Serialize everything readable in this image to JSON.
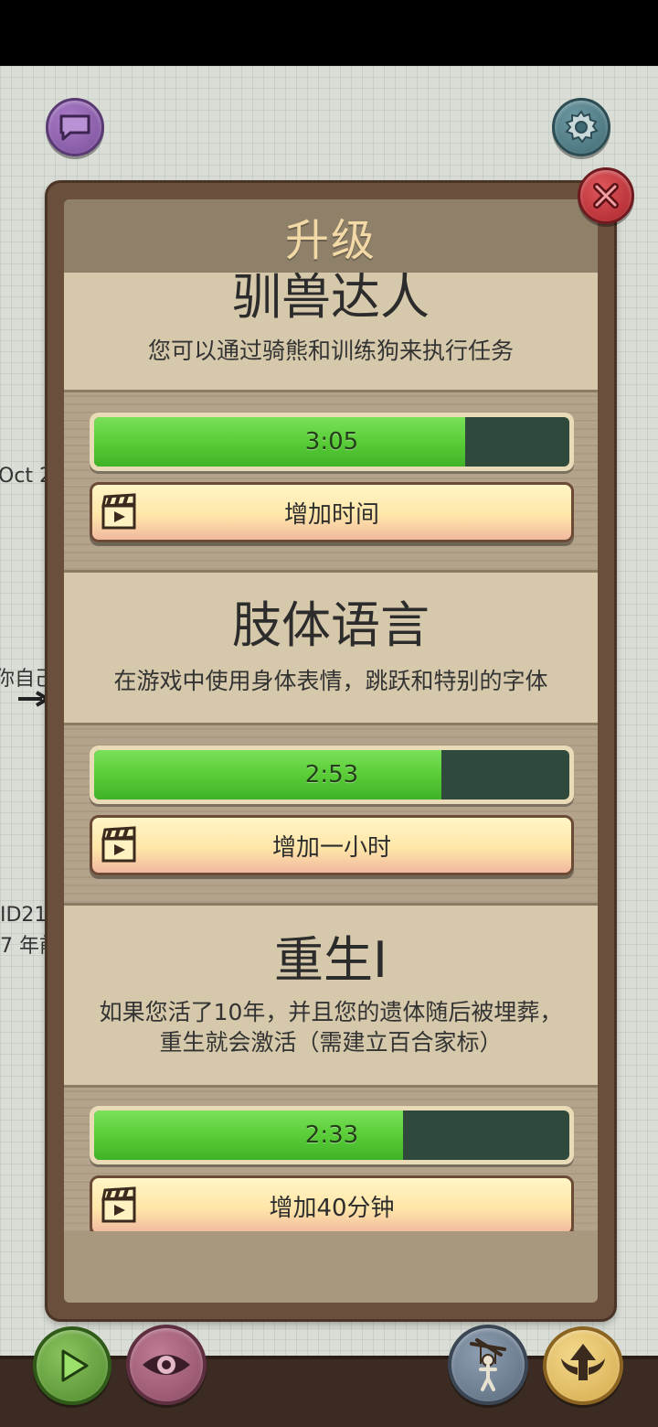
{
  "background": {
    "fragments": [
      "Oct 2",
      "你自己",
      "ID21",
      "7 年前"
    ]
  },
  "dialog": {
    "title": "升级",
    "cards": [
      {
        "title": "驯兽达人",
        "description": [
          "您可以通过骑熊和训练狗来执行任务"
        ],
        "timer": "3:05",
        "progress": 0.78,
        "button_label": "增加时间"
      },
      {
        "title": "肢体语言",
        "description": [
          "在游戏中使用身体表情，跳跃和特别的字体"
        ],
        "timer": "2:53",
        "progress": 0.73,
        "button_label": "增加一小时"
      },
      {
        "title": "重生I",
        "description": [
          "如果您活了10年，并且您的遗体随后被埋葬，",
          "重生就会激活（需建立百合家标）"
        ],
        "timer": "2:33",
        "progress": 0.65,
        "button_label": "增加40分钟"
      }
    ]
  },
  "icons": {
    "chat": "chat-bubble-icon",
    "settings": "gear-icon",
    "close": "close-icon",
    "play": "play-icon",
    "view": "eye-icon",
    "puppet": "puppet-icon",
    "upgrade": "winged-arrow-icon",
    "video": "clapperboard-icon"
  },
  "colors": {
    "progress_fill": "#5ccf3a",
    "progress_track": "#2f4a3c",
    "close_button": "#c8343a",
    "title_text": "#f2d9a6"
  }
}
